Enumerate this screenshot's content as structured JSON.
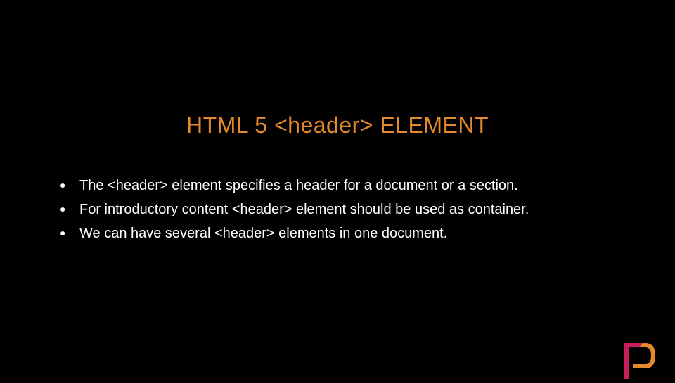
{
  "slide": {
    "title": "HTML 5 <header> ELEMENT",
    "bullets": [
      "The <header> element specifies a header for a document or a section.",
      "For introductory content <header> element should be used as container.",
      "We can have several <header> elements in one document."
    ]
  },
  "colors": {
    "title": "#e58a2c",
    "text": "#ffffff",
    "background": "#000000"
  }
}
